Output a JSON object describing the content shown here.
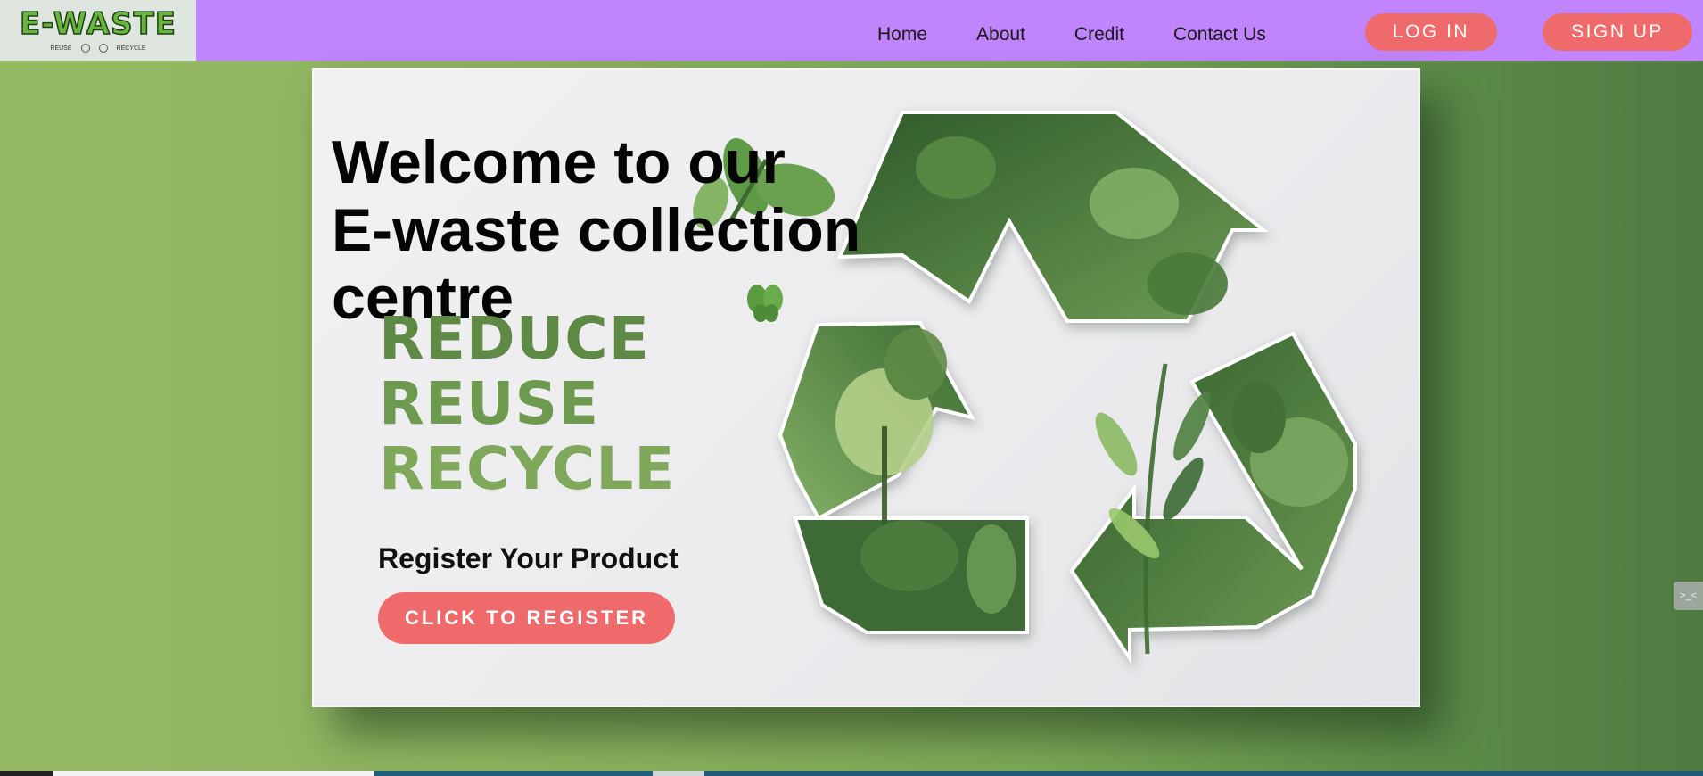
{
  "header": {
    "logo_text": "E-WASTE",
    "logo_tags": [
      "REUSE",
      "RECYCLE"
    ],
    "nav": [
      "Home",
      "About",
      "Credit",
      "Contact Us"
    ],
    "login_label": "LOG IN",
    "signup_label": "SIGN UP"
  },
  "hero": {
    "title_lines": [
      "Welcome to our",
      "E-waste collection",
      "centre"
    ],
    "slogan": [
      "REDUCE",
      "REUSE",
      "RECYCLE"
    ],
    "register_title": "Register Your Product",
    "register_button": "CLICK TO REGISTER"
  },
  "colors": {
    "header_bg": "#c084fc",
    "accent_button": "#ef6b6b",
    "leaf_dark": "#3f6b35",
    "leaf_mid": "#5e8f48",
    "leaf_light": "#a8c978"
  },
  "icons": [
    "recycle-icon",
    "butterfly-icon",
    "side-tab-icon"
  ]
}
